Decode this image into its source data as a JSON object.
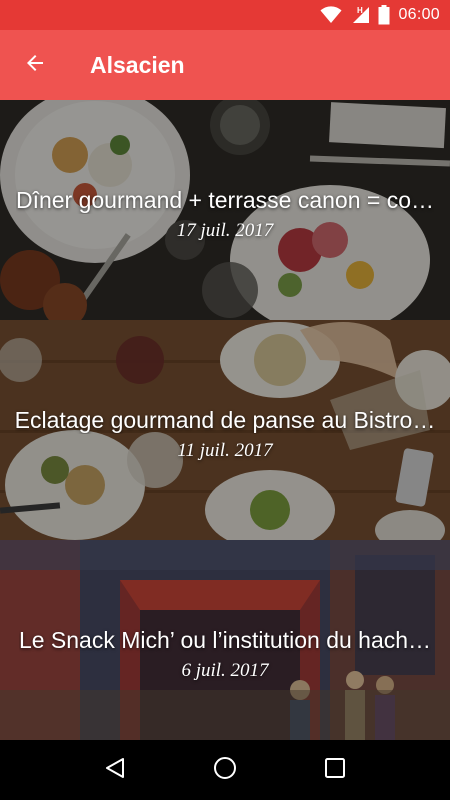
{
  "status_bar": {
    "time": "06:00",
    "network_label": "H",
    "icons": [
      "wifi-icon",
      "signal-icon",
      "battery-icon"
    ]
  },
  "app_bar": {
    "title": "Alsacien",
    "back_icon": "arrow-back-icon",
    "color": "#ef5350",
    "status_color": "#e53935"
  },
  "articles": [
    {
      "title": "Dîner gourmand + terrasse canon = co…",
      "date": "17 juil. 2017"
    },
    {
      "title": "Eclatage gourmand de panse au Bistro…",
      "date": "11 juil. 2017"
    },
    {
      "title": "Le Snack Mich’ ou l’institution du hach…",
      "date": "6 juil. 2017"
    }
  ],
  "nav_bar": {
    "icons": [
      "back-triangle-icon",
      "home-circle-icon",
      "recents-square-icon"
    ]
  }
}
